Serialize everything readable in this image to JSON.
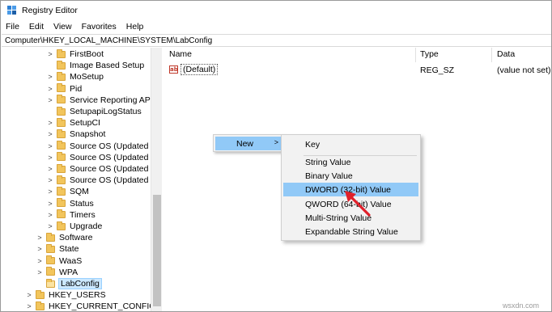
{
  "window": {
    "title": "Registry Editor"
  },
  "menubar": [
    "File",
    "Edit",
    "View",
    "Favorites",
    "Help"
  ],
  "address": "Computer\\HKEY_LOCAL_MACHINE\\SYSTEM\\LabConfig",
  "tree": {
    "items": [
      {
        "label": "FirstBoot",
        "chevron": ">"
      },
      {
        "label": "Image Based Setup",
        "chevron": ""
      },
      {
        "label": "MoSetup",
        "chevron": ">"
      },
      {
        "label": "Pid",
        "chevron": ">"
      },
      {
        "label": "Service Reporting API",
        "chevron": ">"
      },
      {
        "label": "SetupapiLogStatus",
        "chevron": ""
      },
      {
        "label": "SetupCI",
        "chevron": ">"
      },
      {
        "label": "Snapshot",
        "chevron": ">"
      },
      {
        "label": "Source OS (Updated on",
        "chevron": ">"
      },
      {
        "label": "Source OS (Updated on",
        "chevron": ">"
      },
      {
        "label": "Source OS (Updated on",
        "chevron": ">"
      },
      {
        "label": "Source OS (Updated on",
        "chevron": ">"
      },
      {
        "label": "SQM",
        "chevron": ">"
      },
      {
        "label": "Status",
        "chevron": ">"
      },
      {
        "label": "Timers",
        "chevron": ">"
      },
      {
        "label": "Upgrade",
        "chevron": ">"
      },
      {
        "label": "Software",
        "chevron": ">"
      },
      {
        "label": "State",
        "chevron": ">"
      },
      {
        "label": "WaaS",
        "chevron": ">"
      },
      {
        "label": "WPA",
        "chevron": ">"
      },
      {
        "label": "LabConfig",
        "chevron": ""
      },
      {
        "label": "HKEY_USERS",
        "chevron": ">"
      },
      {
        "label": "HKEY_CURRENT_CONFIG",
        "chevron": ">"
      }
    ]
  },
  "list": {
    "columns": {
      "name": "Name",
      "type": "Type",
      "data": "Data"
    },
    "rows": [
      {
        "icon": "ab",
        "name": "(Default)",
        "type": "REG_SZ",
        "data": "(value not set)"
      }
    ]
  },
  "context_menu": {
    "new_label": "New",
    "new_arrow": ">",
    "submenu": [
      "Key",
      "String Value",
      "Binary Value",
      "DWORD (32-bit) Value",
      "QWORD (64-bit) Value",
      "Multi-String Value",
      "Expandable String Value"
    ],
    "highlighted": "DWORD (32-bit) Value"
  },
  "watermark": "wsxdn.com",
  "colors": {
    "selection": "#cce8ff",
    "menu_highlight": "#91c9f7",
    "folder": "#f2c55c",
    "arrow": "#e0202a"
  },
  "icons": {
    "app": "registry-editor-icon",
    "folder": "folder-icon",
    "string_value": "ab-string-icon",
    "annotation": "red-arrow-icon"
  }
}
